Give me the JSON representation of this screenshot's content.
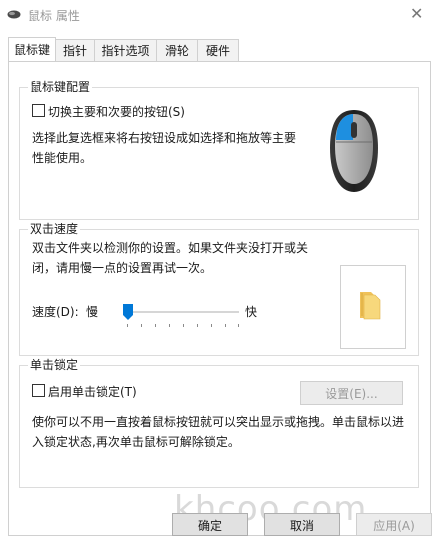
{
  "window": {
    "title": "鼠标 属性"
  },
  "tabs": [
    {
      "label": "鼠标键"
    },
    {
      "label": "指针"
    },
    {
      "label": "指针选项"
    },
    {
      "label": "滑轮"
    },
    {
      "label": "硬件"
    }
  ],
  "button_config": {
    "title": "鼠标键配置",
    "switch_label": "切换主要和次要的按钮(S)",
    "switch_checked": false,
    "desc_line1": "选择此复选框来将右按钮设成如选择和拖放等主要",
    "desc_line2": "性能使用。"
  },
  "double_click": {
    "title": "双击速度",
    "desc_line1": "双击文件夹以检测你的设置。如果文件夹没打开或关",
    "desc_line2": "闭，请用慢一点的设置再试一次。",
    "speed_label": "速度(D):",
    "slow_label": "慢",
    "fast_label": "快",
    "speed_value": 0.0
  },
  "click_lock": {
    "title": "单击锁定",
    "enable_label": "启用单击锁定(T)",
    "enable_checked": false,
    "settings_button": "设置(E)...",
    "desc_line1": "使你可以不用一直按着鼠标按钮就可以突出显示或拖拽。单击鼠标以进",
    "desc_line2": "入锁定状态,再次单击鼠标可解除锁定。"
  },
  "footer": {
    "ok": "确定",
    "cancel": "取消",
    "apply": "应用(A)",
    "watermark": "khcoo.com"
  }
}
